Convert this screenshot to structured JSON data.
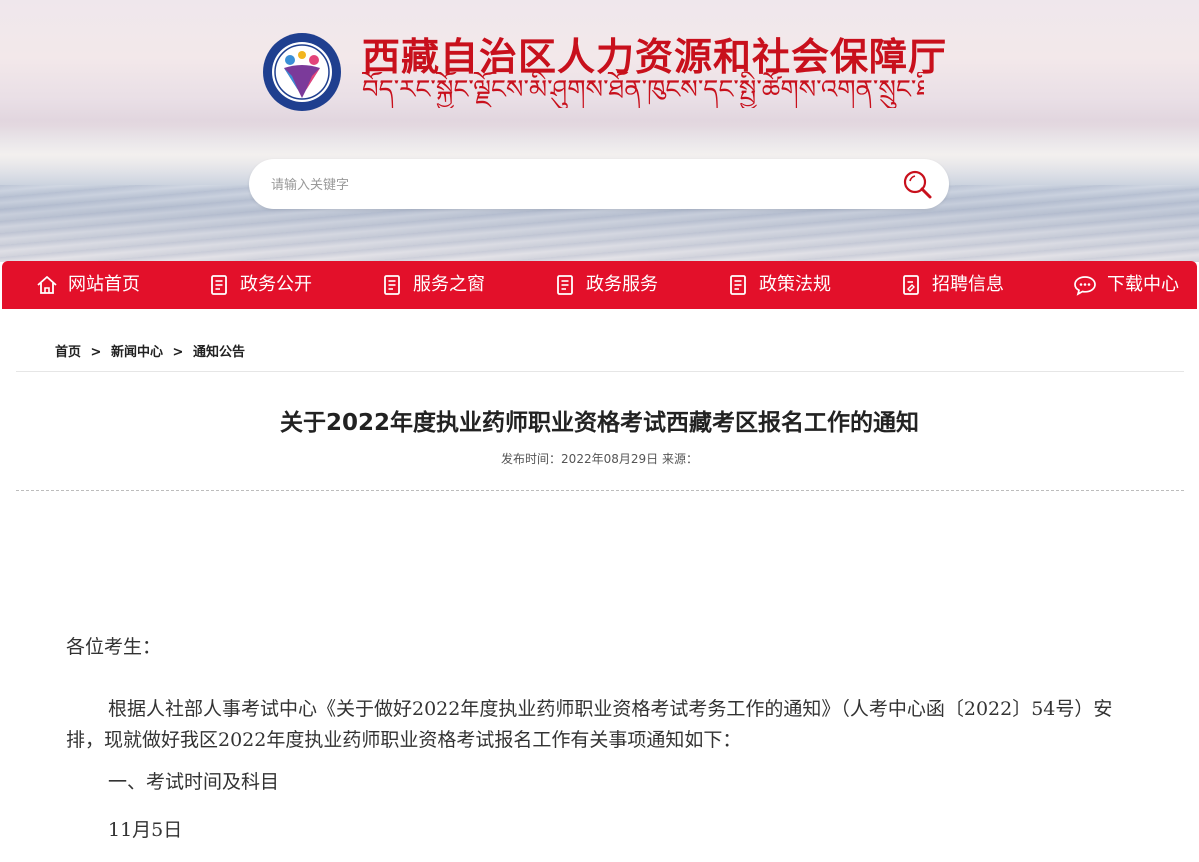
{
  "header": {
    "title": "西藏自治区人力资源和社会保障厅",
    "title_tibetan": "བོད་རང་སྐྱོང་ལྗོངས་མི་ཤུགས་ཐོན་ཁུངས་དང་སྤྱི་ཚོགས་འགན་སྲུང་ཐིང་།",
    "brand_color": "#c8101c",
    "search": {
      "placeholder": "请输入关键字",
      "value": ""
    }
  },
  "nav": {
    "color": "#e3102a",
    "items": [
      {
        "label": "网站首页",
        "icon": "home-icon"
      },
      {
        "label": "政务公开",
        "icon": "document-icon"
      },
      {
        "label": "服务之窗",
        "icon": "document-icon"
      },
      {
        "label": "政务服务",
        "icon": "document-icon"
      },
      {
        "label": "政策法规",
        "icon": "document-icon"
      },
      {
        "label": "招聘信息",
        "icon": "document-edit-icon"
      },
      {
        "label": "下载中心",
        "icon": "chat-icon"
      }
    ]
  },
  "breadcrumb": {
    "items": [
      "首页",
      "新闻中心",
      "通知公告"
    ],
    "separator": ">"
  },
  "article": {
    "title": "关于2022年度执业药师职业资格考试西藏考区报名工作的通知",
    "meta": "发布时间：2022年08月29日 来源：",
    "greeting": "各位考生：",
    "paragraph_1": "根据人社部人事考试中心《关于做好2022年度执业药师职业资格考试考务工作的通知》（人考中心函〔2022〕54号）安排，现就做好我区2022年度执业药师职业资格考试报名工作有关事项通知如下：",
    "heading_1": "一、考试时间及科目",
    "date_line": "11月5日"
  }
}
